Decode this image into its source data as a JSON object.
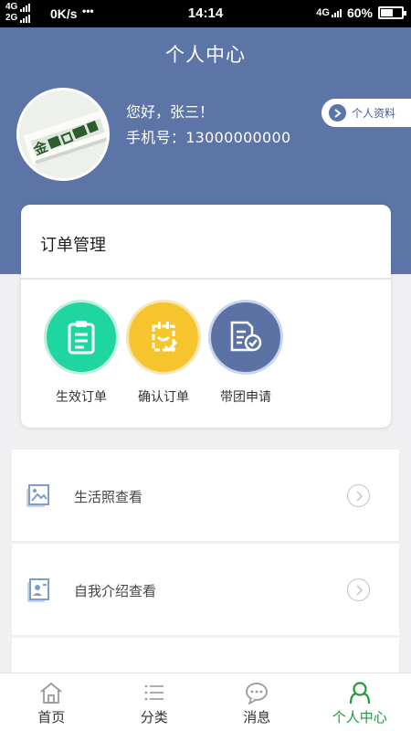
{
  "status_bar": {
    "network_top": "4G",
    "network_bottom": "2G",
    "speed": "0K/s",
    "time": "14:14",
    "network_right": "4G",
    "battery": "60%",
    "battery_level": 0.6
  },
  "header": {
    "title": "个人中心",
    "greeting": "您好，张三！",
    "phone": "手机号：13000000000",
    "profile_button": "个人资料"
  },
  "orders": {
    "title": "订单管理",
    "items": [
      {
        "label": "生效订单",
        "icon": "clipboard-icon",
        "color": "#1fd6a0",
        "ring": "#c3eedd"
      },
      {
        "label": "确认订单",
        "icon": "confirm-icon",
        "color": "#f6c52e",
        "ring": "#f7e6b5"
      },
      {
        "label": "带团申请",
        "icon": "document-check-icon",
        "color": "#5c72a5",
        "ring": "#c8d4f0"
      }
    ]
  },
  "menu": [
    {
      "label": "生活照查看",
      "icon": "photo-icon"
    },
    {
      "label": "自我介绍查看",
      "icon": "profile-card-icon"
    },
    {
      "label": "",
      "icon": "document-icon"
    }
  ],
  "nav": [
    {
      "label": "首页",
      "icon": "home-icon"
    },
    {
      "label": "分类",
      "icon": "list-icon"
    },
    {
      "label": "消息",
      "icon": "message-icon"
    },
    {
      "label": "个人中心",
      "icon": "user-icon",
      "active": true
    }
  ],
  "colors": {
    "header": "#5d75a6",
    "active_nav": "#1f9a3c"
  }
}
